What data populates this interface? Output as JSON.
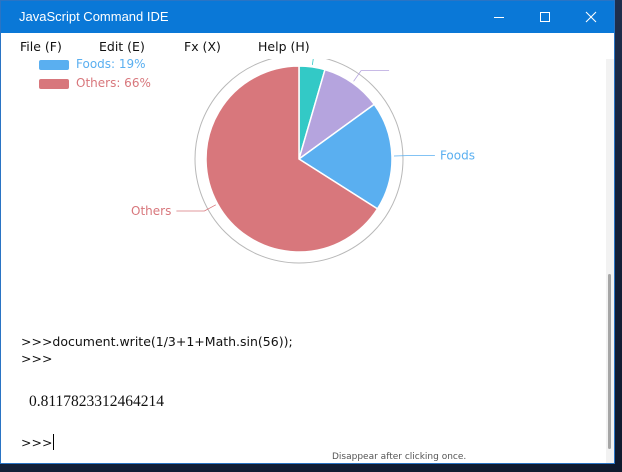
{
  "window": {
    "title": "JavaScript Command IDE",
    "controls": {
      "minimize": "minimize-icon",
      "maximize": "maximize-icon",
      "close": "close-icon"
    }
  },
  "menu": {
    "items": [
      {
        "label": "File (F)"
      },
      {
        "label": "Edit (E)"
      },
      {
        "label": "Fx (X)"
      },
      {
        "label": "Help (H)"
      }
    ]
  },
  "chart_data": {
    "type": "pie",
    "legend": [
      {
        "text": "Foods: 19%",
        "color": "#5aaff0"
      },
      {
        "text": "Others: 66%",
        "color": "#d8777c"
      }
    ],
    "slices": [
      {
        "name": "",
        "value": 4.5,
        "color": "#33c9c6",
        "label": ""
      },
      {
        "name": "",
        "value": 10.5,
        "color": "#b5a4de",
        "label": ""
      },
      {
        "name": "Foods",
        "value": 19,
        "color": "#5aaff0",
        "label": "Foods"
      },
      {
        "name": "Others",
        "value": 66,
        "color": "#d8777c",
        "label": "Others"
      }
    ],
    "start_angle_deg": 0,
    "direction": "clockwise",
    "outer_ring": true
  },
  "console": {
    "command": ">>>document.write(1/3+1+Math.sin(56));",
    "prompt_after_command": ">>>",
    "result": "0.8117823312464214",
    "active_prompt": ">>>",
    "hint": "Disappear after clicking once."
  }
}
